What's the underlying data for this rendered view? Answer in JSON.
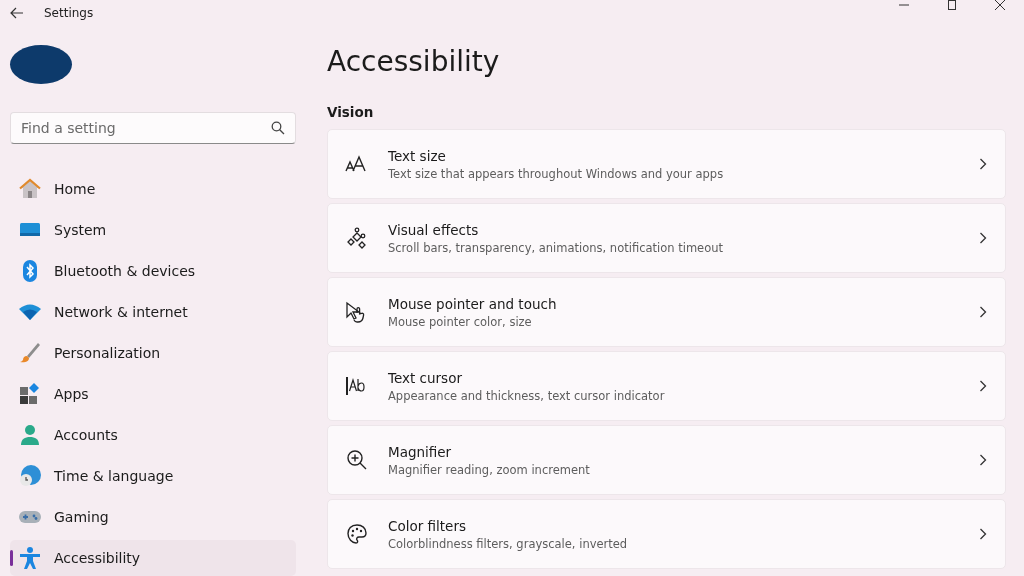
{
  "window": {
    "title": "Settings"
  },
  "search": {
    "placeholder": "Find a setting"
  },
  "nav": [
    {
      "label": "Home",
      "selected": false
    },
    {
      "label": "System",
      "selected": false
    },
    {
      "label": "Bluetooth & devices",
      "selected": false
    },
    {
      "label": "Network & internet",
      "selected": false
    },
    {
      "label": "Personalization",
      "selected": false
    },
    {
      "label": "Apps",
      "selected": false
    },
    {
      "label": "Accounts",
      "selected": false
    },
    {
      "label": "Time & language",
      "selected": false
    },
    {
      "label": "Gaming",
      "selected": false
    },
    {
      "label": "Accessibility",
      "selected": true
    }
  ],
  "page": {
    "title": "Accessibility",
    "section": "Vision"
  },
  "cards": [
    {
      "title": "Text size",
      "subtitle": "Text size that appears throughout Windows and your apps"
    },
    {
      "title": "Visual effects",
      "subtitle": "Scroll bars, transparency, animations, notification timeout"
    },
    {
      "title": "Mouse pointer and touch",
      "subtitle": "Mouse pointer color, size"
    },
    {
      "title": "Text cursor",
      "subtitle": "Appearance and thickness, text cursor indicator"
    },
    {
      "title": "Magnifier",
      "subtitle": "Magnifier reading, zoom increment"
    },
    {
      "title": "Color filters",
      "subtitle": "Colorblindness filters, grayscale, inverted"
    }
  ]
}
